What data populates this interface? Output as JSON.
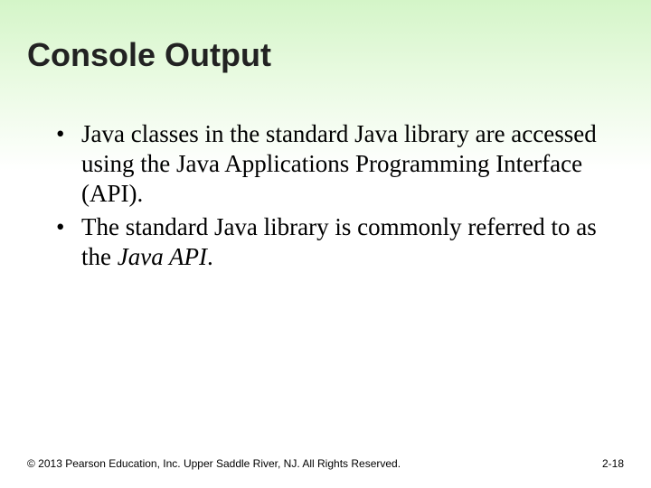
{
  "title": "Console Output",
  "bullets": [
    {
      "prefix": "Java classes in the standard Java library are accessed using the Java Applications Programming Interface (API).",
      "italic": "",
      "suffix": ""
    },
    {
      "prefix": "The standard Java library is commonly referred to as the ",
      "italic": "Java API",
      "suffix": "."
    }
  ],
  "footer": {
    "copyright": "© 2013 Pearson Education, Inc. Upper Saddle River, NJ. All Rights Reserved.",
    "page": "2-18"
  }
}
